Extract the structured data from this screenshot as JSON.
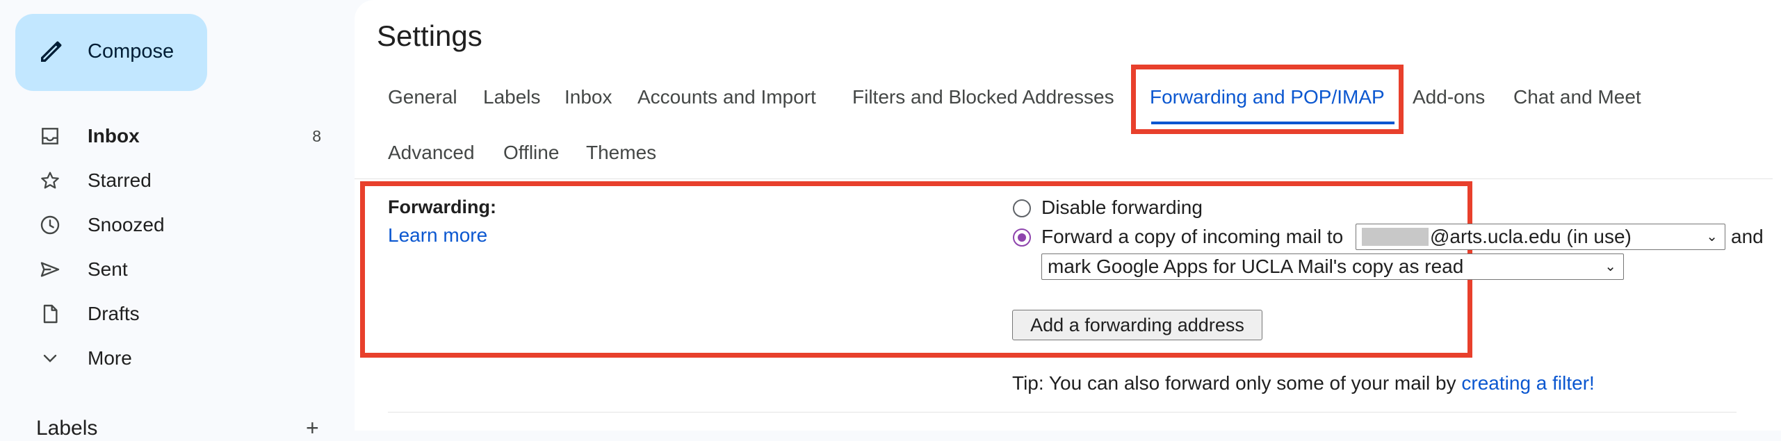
{
  "compose": {
    "label": "Compose",
    "icon": "pencil-icon"
  },
  "nav": [
    {
      "label": "Inbox",
      "count": "8",
      "icon": "inbox-icon",
      "active": true
    },
    {
      "label": "Starred",
      "icon": "star-icon"
    },
    {
      "label": "Snoozed",
      "icon": "clock-icon"
    },
    {
      "label": "Sent",
      "icon": "send-icon"
    },
    {
      "label": "Drafts",
      "icon": "draft-icon"
    },
    {
      "label": "More",
      "icon": "chevron-down-icon"
    }
  ],
  "labels": {
    "heading": "Labels",
    "add": "+"
  },
  "settings": {
    "title": "Settings",
    "tabs": [
      "General",
      "Labels",
      "Inbox",
      "Accounts and Import",
      "Filters and Blocked Addresses",
      "Forwarding and POP/IMAP",
      "Add-ons",
      "Chat and Meet",
      "Advanced",
      "Offline",
      "Themes"
    ],
    "active_tab": "Forwarding and POP/IMAP"
  },
  "forwarding": {
    "title": "Forwarding:",
    "learn_more": "Learn more",
    "disable_option": "Disable forwarding",
    "forward_option": "Forward a copy of incoming mail to",
    "selected_option": "forward",
    "address_select": "@arts.ucla.edu (in use)",
    "and_text": "and",
    "action_select": "mark Google Apps for UCLA Mail's copy as read",
    "add_button": "Add a forwarding address",
    "tip_prefix": "Tip: You can also forward only some of your mail by",
    "tip_link": "creating a filter!"
  },
  "colors": {
    "accent": "#0b57d0",
    "compose_bg": "#c2e7ff",
    "highlight": "#e8402c",
    "radio_checked": "#8e44ad"
  }
}
